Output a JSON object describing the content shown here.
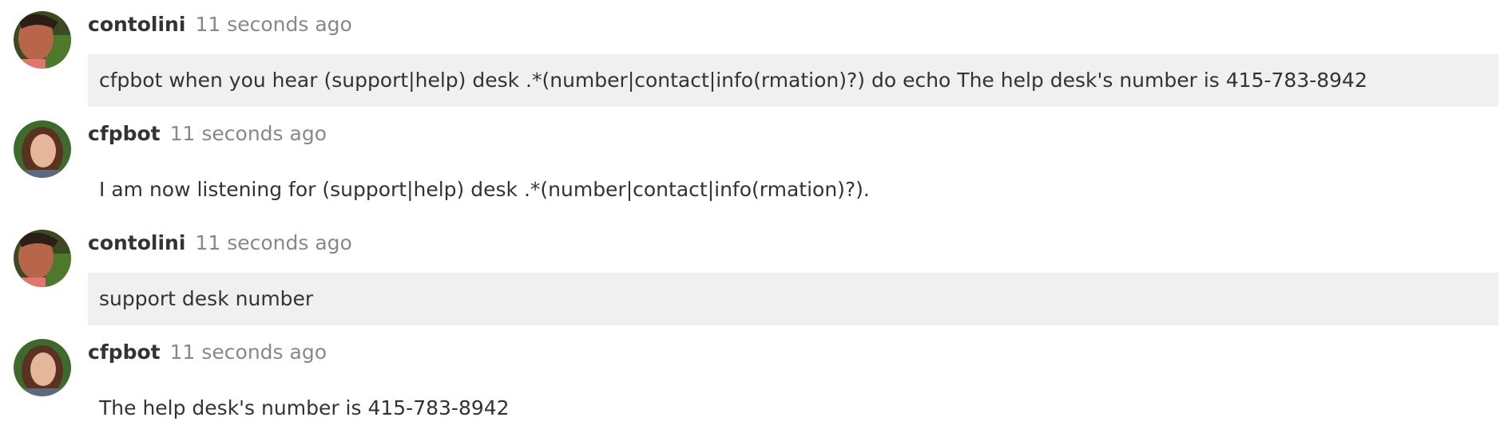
{
  "messages": [
    {
      "user": "contolini",
      "time": "11 seconds ago",
      "text": "cfpbot when you hear (support|help) desk .*(number|contact|info(rmation)?) do echo The help desk's number is 415-783-8942",
      "highlighted": true,
      "avatar": "man-avatar"
    },
    {
      "user": "cfpbot",
      "time": "11 seconds ago",
      "text": "I am now listening for (support|help) desk .*(number|contact|info(rmation)?).",
      "highlighted": false,
      "avatar": "woman-avatar"
    },
    {
      "user": "contolini",
      "time": "11 seconds ago",
      "text": "support desk number",
      "highlighted": true,
      "avatar": "man-avatar"
    },
    {
      "user": "cfpbot",
      "time": "11 seconds ago",
      "text": "The help desk's number is 415-783-8942",
      "highlighted": false,
      "avatar": "woman-avatar"
    }
  ]
}
